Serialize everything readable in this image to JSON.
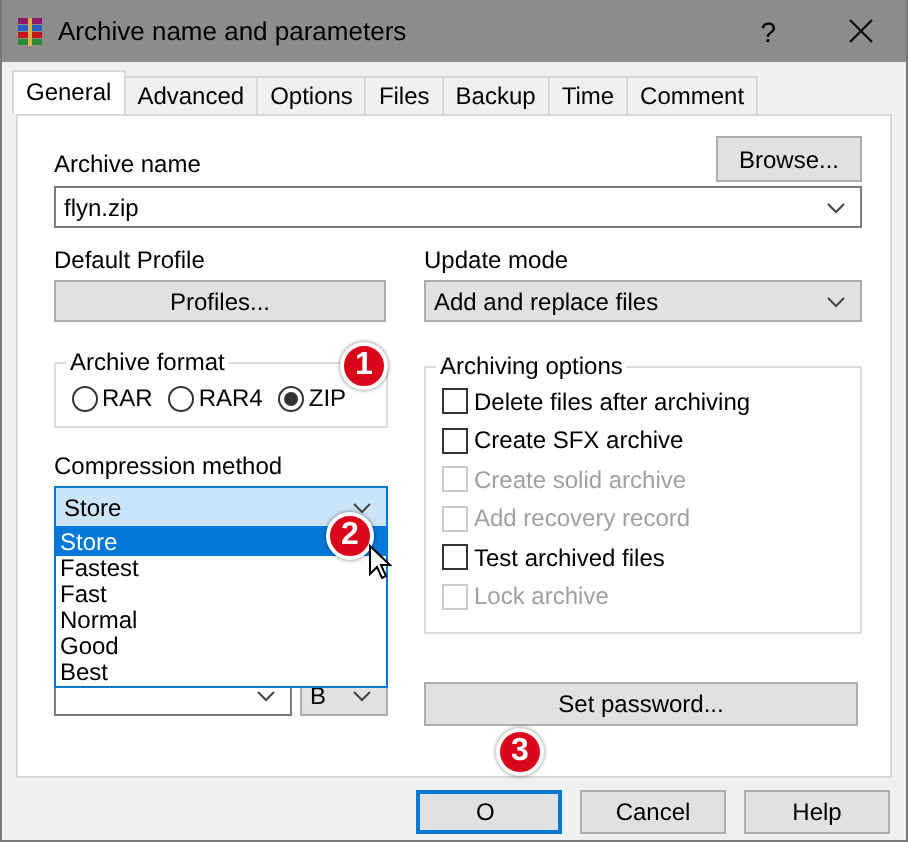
{
  "window": {
    "title": "Archive name and parameters",
    "help": "?"
  },
  "tabs": [
    {
      "label": "General",
      "selected": true
    },
    {
      "label": "Advanced",
      "selected": false
    },
    {
      "label": "Options",
      "selected": false
    },
    {
      "label": "Files",
      "selected": false
    },
    {
      "label": "Backup",
      "selected": false
    },
    {
      "label": "Time",
      "selected": false
    },
    {
      "label": "Comment",
      "selected": false
    }
  ],
  "archive_name": {
    "label": "Archive name",
    "value": "flyn.zip",
    "browse_button": "Browse..."
  },
  "default_profile": {
    "label": "Default Profile",
    "button": "Profiles..."
  },
  "update_mode": {
    "label": "Update mode",
    "value": "Add and replace files"
  },
  "archive_format": {
    "label": "Archive format",
    "options": [
      {
        "label": "RAR",
        "selected": false
      },
      {
        "label": "RAR4",
        "selected": false
      },
      {
        "label": "ZIP",
        "selected": true
      }
    ]
  },
  "compression_method": {
    "label": "Compression method",
    "value": "Store",
    "expanded": true,
    "options": [
      {
        "label": "Store",
        "selected": true
      },
      {
        "label": "Fastest",
        "selected": false
      },
      {
        "label": "Fast",
        "selected": false
      },
      {
        "label": "Normal",
        "selected": false
      },
      {
        "label": "Good",
        "selected": false
      },
      {
        "label": "Best",
        "selected": false
      }
    ]
  },
  "dictionary_unit": {
    "value": "B"
  },
  "archiving_options": {
    "label": "Archiving options",
    "options": [
      {
        "label": "Delete files after archiving",
        "checked": false,
        "disabled": false
      },
      {
        "label": "Create SFX archive",
        "checked": false,
        "disabled": false
      },
      {
        "label": "Create solid archive",
        "checked": false,
        "disabled": true
      },
      {
        "label": "Add recovery record",
        "checked": false,
        "disabled": true
      },
      {
        "label": "Test archived files",
        "checked": false,
        "disabled": false
      },
      {
        "label": "Lock archive",
        "checked": false,
        "disabled": true
      }
    ]
  },
  "set_password_button": "Set password...",
  "buttons": [
    {
      "label": "O",
      "default": true
    },
    {
      "label": "Cancel",
      "default": false
    },
    {
      "label": "Help",
      "default": false
    }
  ],
  "step_badges": [
    "1",
    "2",
    "3"
  ]
}
